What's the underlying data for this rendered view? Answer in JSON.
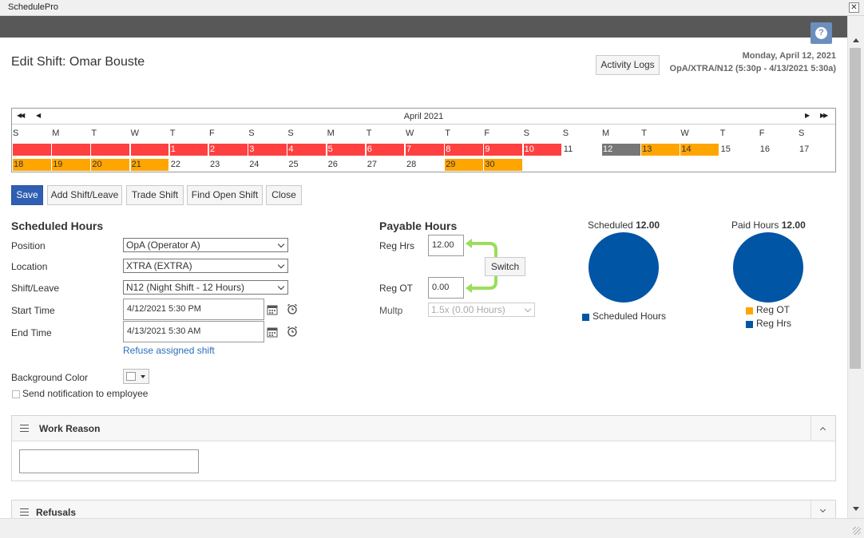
{
  "window": {
    "title": "SchedulePro",
    "close_glyph": "✕"
  },
  "help": {
    "glyph": "?"
  },
  "header": {
    "title": "Edit Shift: Omar Bouste",
    "activity_logs_label": "Activity Logs",
    "date": "Monday, April 12, 2021",
    "shift_summary": "OpA/XTRA/N12 (5:30p - 4/13/2021 5:30a)"
  },
  "calendar": {
    "month": "April 2021",
    "nav": {
      "first": "◀◀",
      "prev": "◀",
      "next": "▶",
      "last": "▶▶"
    },
    "weekdays": [
      "S",
      "M",
      "T",
      "W",
      "T",
      "F",
      "S",
      "S",
      "M",
      "T",
      "W",
      "T",
      "F",
      "S",
      "S",
      "M",
      "T",
      "W",
      "T",
      "F",
      "S"
    ],
    "row1": [
      "",
      "",
      "",
      "",
      "1",
      "2",
      "3",
      "4",
      "5",
      "6",
      "7",
      "8",
      "9",
      "10",
      "11",
      "12",
      "13",
      "14",
      "15",
      "16",
      "17"
    ],
    "row2": [
      "18",
      "19",
      "20",
      "21",
      "22",
      "23",
      "24",
      "25",
      "26",
      "27",
      "28",
      "29",
      "30"
    ],
    "colors": {
      "scheduled": "#ff4040",
      "overtime": "#ffa500",
      "selected": "#777777"
    }
  },
  "actions": {
    "save": "Save",
    "add_shift_leave": "Add Shift/Leave",
    "trade_shift": "Trade Shift",
    "find_open_shift": "Find Open Shift",
    "close": "Close"
  },
  "scheduled_hours": {
    "title": "Scheduled Hours",
    "position": {
      "label": "Position",
      "value": "OpA (Operator A)"
    },
    "location": {
      "label": "Location",
      "value": "XTRA (EXTRA)"
    },
    "shift_leave": {
      "label": "Shift/Leave",
      "value": "N12 (Night Shift - 12 Hours)"
    },
    "start_time": {
      "label": "Start Time",
      "value": "4/12/2021 5:30 PM"
    },
    "end_time": {
      "label": "End Time",
      "value": "4/13/2021 5:30 AM"
    },
    "refuse_link": "Refuse assigned shift",
    "background_color_label": "Background Color",
    "notify_label": "Send notification to employee"
  },
  "payable_hours": {
    "title": "Payable Hours",
    "reg_hrs": {
      "label": "Reg Hrs",
      "value": "12.00"
    },
    "reg_ot": {
      "label": "Reg OT",
      "value": "0.00"
    },
    "switch_label": "Switch",
    "multp": {
      "label": "Multp",
      "value": "1.5x (0.00 Hours)"
    }
  },
  "chart_data": [
    {
      "type": "pie",
      "title_prefix": "Scheduled",
      "title_value": "12.00",
      "categories": [
        "Scheduled Hours"
      ],
      "values": [
        12.0
      ],
      "colors": [
        "#0055a5"
      ]
    },
    {
      "type": "pie",
      "title_prefix": "Paid Hours",
      "title_value": "12.00",
      "categories": [
        "Reg OT",
        "Reg Hrs"
      ],
      "values": [
        0.0,
        12.0
      ],
      "colors": [
        "#ffa500",
        "#0055a5"
      ]
    }
  ],
  "panels": {
    "work_reason": {
      "title": "Work Reason",
      "value": ""
    },
    "refusals": {
      "title": "Refusals"
    }
  }
}
